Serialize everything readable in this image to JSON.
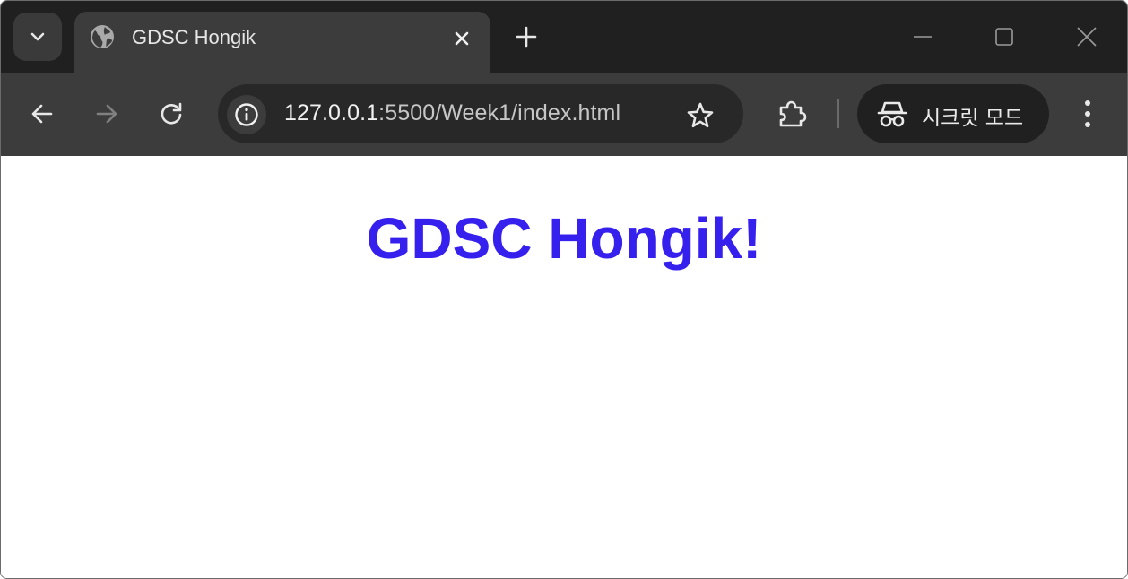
{
  "browser": {
    "tab": {
      "title": "GDSC Hongik",
      "favicon": "globe-icon"
    },
    "omnibox": {
      "url_host": "127.0.0.1",
      "url_rest": ":5500/Week1/index.html"
    },
    "incognito": {
      "label": "시크릿 모드",
      "icon": "incognito-icon"
    },
    "icons": {
      "tab_search": "chevron-down-icon",
      "close_tab": "close-icon",
      "new_tab": "plus-icon",
      "minimize": "minimize-icon",
      "maximize": "maximize-icon",
      "close_window": "close-window-icon",
      "back": "back-arrow-icon",
      "forward": "forward-arrow-icon",
      "reload": "reload-icon",
      "site_info": "info-icon",
      "bookmark": "star-icon",
      "extensions": "puzzle-icon",
      "menu": "kebab-menu-icon"
    },
    "colors": {
      "frame": "#202020",
      "toolbar": "#3c3c3c",
      "omnibox": "#282828"
    }
  },
  "page": {
    "heading": "GDSC Hongik!",
    "heading_color": "#3520EE",
    "background": "#ffffff"
  }
}
